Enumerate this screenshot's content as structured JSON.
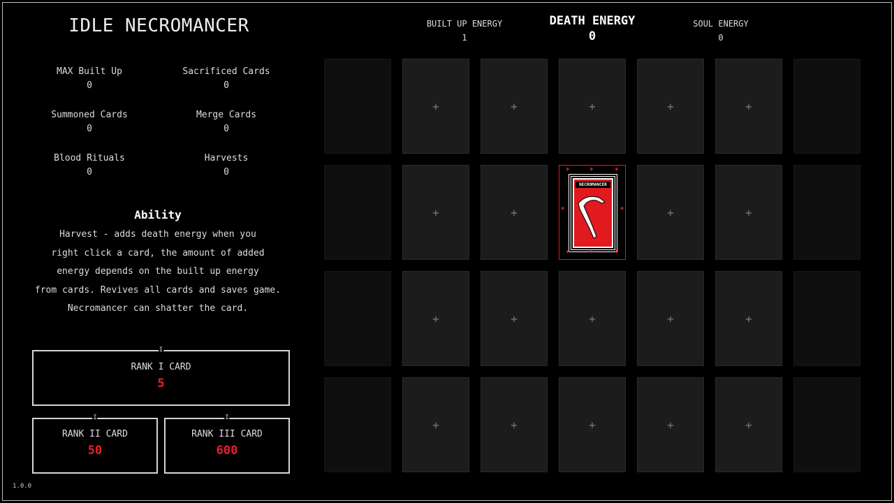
{
  "title": "IDLE NECROMANCER",
  "stats": [
    {
      "label": "MAX Built Up",
      "value": "0"
    },
    {
      "label": "Sacrificed Cards",
      "value": "0"
    },
    {
      "label": "Summoned Cards",
      "value": "0"
    },
    {
      "label": "Merge Cards",
      "value": "0"
    },
    {
      "label": "Blood Rituals",
      "value": "0"
    },
    {
      "label": "Harvests",
      "value": "0"
    }
  ],
  "ability": {
    "title": "Ability",
    "lines": [
      "Harvest - adds death energy when you",
      "right click a card, the amount of added",
      "energy depends on the built up energy",
      "from cards. Revives all cards and saves game.",
      "Necromancer can shatter the card."
    ]
  },
  "ranks": [
    {
      "pip": "I",
      "label": "RANK I CARD",
      "cost": "5"
    },
    {
      "pip": "I",
      "label": "RANK II CARD",
      "cost": "50"
    },
    {
      "pip": "I",
      "label": "RANK III CARD",
      "cost": "600"
    }
  ],
  "version": "1.0.0",
  "energy": {
    "built_up": {
      "label": "BUILT UP ENERGY",
      "value": "1"
    },
    "death": {
      "label": "DEATH ENERGY",
      "value": "0"
    },
    "soul": {
      "label": "SOUL ENERGY",
      "value": "0"
    }
  },
  "board": {
    "rows": 4,
    "cols": 7,
    "locked_columns": [
      0,
      6
    ],
    "empty_slot_symbol": "+",
    "necromancer": {
      "row": 1,
      "col": 3,
      "name": "NECROMANCER",
      "mark_symbol": "+"
    }
  },
  "colors": {
    "accent_red": "#e01a1f",
    "slot": "#1c1c1c",
    "locked_slot": "#0f0f0f",
    "background": "#000000"
  }
}
